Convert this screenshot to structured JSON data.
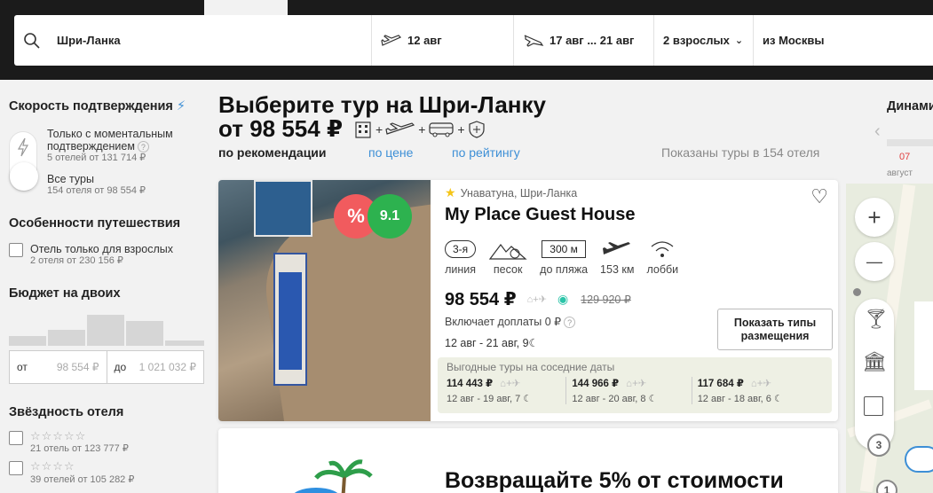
{
  "search": {
    "destination": "Шри-Ланка",
    "date": "12 авг",
    "nights_range": "17 авг ... 21 авг",
    "adults": "2 взрослых",
    "from": "из Москвы"
  },
  "sidebar": {
    "confirm_title": "Скорость подтверждения",
    "instant_label": "Только с моментальным подтверждением",
    "instant_sub": "5 отелей от 131 714 ₽",
    "all_label": "Все туры",
    "all_sub": "154 отеля от 98 554 ₽",
    "features_title": "Особенности путешествия",
    "adults_only_label": "Отель только для взрослых",
    "adults_only_sub": "2 отеля от 230 156 ₽",
    "budget_title": "Бюджет на двоих",
    "budget_from_label": "от",
    "budget_from_value": "98 554 ₽",
    "budget_to_label": "до",
    "budget_to_value": "1 021 032 ₽",
    "budget_hist": [
      0.28,
      0.46,
      0.88,
      0.69,
      0.14
    ],
    "stars_title": "Звёздность отеля",
    "stars5_sub": "21 отель от 123 777 ₽",
    "stars4_sub": "39 отелей от 105 282 ₽"
  },
  "main": {
    "title": "Выберите тур на Шри-Ланку",
    "price_from": "от 98 554 ₽",
    "sort_reco": "по рекомендации",
    "sort_price": "по цене",
    "sort_rating": "по рейтингу",
    "shown": "Показаны туры в 154 отеля"
  },
  "card": {
    "discount_badge": "%",
    "rating": "9.1",
    "location": "Унаватуна, Шри-Ланка",
    "name": "My Place Guest House",
    "line_value": "3-я",
    "line_label": "линия",
    "sand_label": "песок",
    "beach_value": "300 м",
    "beach_label": "до пляжа",
    "airport_label": "153 км",
    "lobby_label": "лобби",
    "price": "98 554 ₽",
    "old_price": "129 920 ₽",
    "includes": "Включает доплаты 0 ₽",
    "dates": "12 авг - 21 авг, 9",
    "button": "Показать типы размещения",
    "nearby_title": "Выгодные туры на соседние даты",
    "nearby": [
      {
        "price": "114 443 ₽",
        "dates": "12 авг - 19 авг, 7"
      },
      {
        "price": "144 966 ₽",
        "dates": "12 авг - 20 авг, 8"
      },
      {
        "price": "117 684 ₽",
        "dates": "12 авг - 18 авг, 6"
      }
    ]
  },
  "promo": {
    "text": "Возвращайте 5% от стоимости"
  },
  "right": {
    "dynamics_title": "Динамика",
    "day": "07",
    "month": "август"
  },
  "map": {
    "zoom_in": "+",
    "zoom_out": "—",
    "cluster1": "3",
    "cluster2": "1"
  }
}
